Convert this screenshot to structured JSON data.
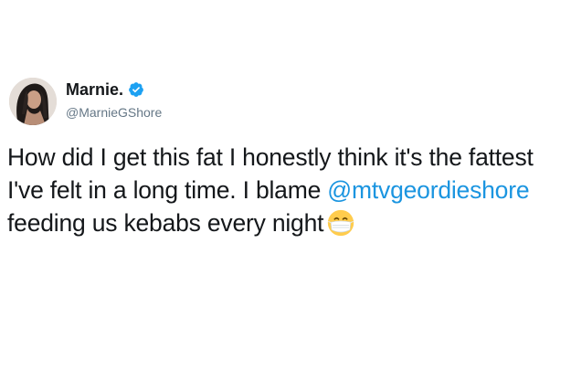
{
  "author": {
    "display_name": "Marnie.",
    "handle": "@MarnieGShore",
    "verified": true,
    "verified_color": "#1da1f2",
    "avatar_icon": "profile-photo"
  },
  "tweet": {
    "text_before_mention": "How did I get this fat I honestly think it's the fattest I've felt in a long time. I blame ",
    "mention": "@mtvgeordieshore",
    "text_after_mention": " feeding us kebabs every night",
    "emoji": "face-with-medical-mask",
    "mention_color": "#1b95e0",
    "text_color": "#14171a"
  }
}
